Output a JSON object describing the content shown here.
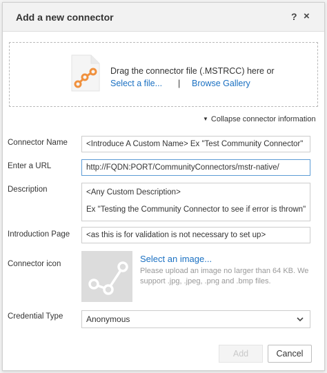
{
  "dialog": {
    "title": "Add a new connector",
    "help_label": "?",
    "close_label": "×"
  },
  "dropzone": {
    "text": "Drag the connector file (.MSTRCC) here or",
    "select_file_link": "Select a file...",
    "separator": "|",
    "browse_gallery_link": "Browse Gallery",
    "icon": "connector-file-icon"
  },
  "collapse_toggle": {
    "label": "Collapse connector information"
  },
  "form": {
    "connector_name": {
      "label": "Connector Name",
      "value": "<Introduce A Custom Name> Ex \"Test Community Connector\""
    },
    "url": {
      "label": "Enter a URL",
      "value": "http://FQDN:PORT/CommunityConnectors/mstr-native/"
    },
    "description": {
      "label": "Description",
      "line1": "<Any Custom Description>",
      "line2": "Ex \"Testing the Community Connector to see if error is thrown\""
    },
    "intro_page": {
      "label": "Introduction Page",
      "value": "<as this is for validation is not necessary to set up>"
    },
    "connector_icon": {
      "label": "Connector icon",
      "select_link": "Select an image...",
      "hint": "Please upload an image no larger than 64 KB. We support .jpg, .jpeg, .png and .bmp files."
    },
    "credential_type": {
      "label": "Credential Type",
      "selected": "Anonymous"
    }
  },
  "buttons": {
    "add": "Add",
    "cancel": "Cancel"
  },
  "colors": {
    "link": "#1a70c2",
    "accent_icon": "#f0913e",
    "focus_border": "#5b9bd5"
  }
}
